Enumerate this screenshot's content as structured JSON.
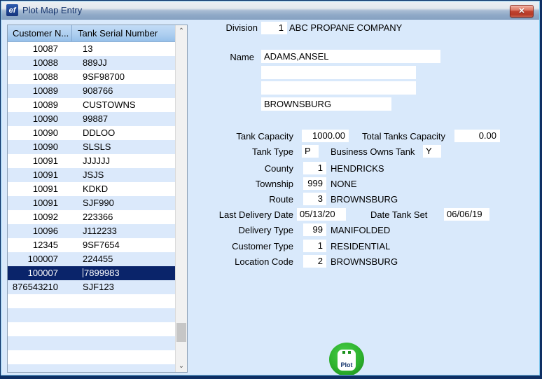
{
  "window": {
    "title": "Plot Map Entry",
    "icon_text": "ef",
    "close_glyph": "✕"
  },
  "table": {
    "columns": [
      "Customer N...",
      "Tank Serial Number"
    ],
    "rows": [
      [
        "10087",
        "13"
      ],
      [
        "10088",
        "889JJ"
      ],
      [
        "10088",
        "9SF98700"
      ],
      [
        "10089",
        "908766"
      ],
      [
        "10089",
        "CUSTOWNS"
      ],
      [
        "10090",
        "99887"
      ],
      [
        "10090",
        "DDLOO"
      ],
      [
        "10090",
        "SLSLS"
      ],
      [
        "10091",
        "JJJJJJ"
      ],
      [
        "10091",
        "JSJS"
      ],
      [
        "10091",
        "KDKD"
      ],
      [
        "10091",
        "SJF990"
      ],
      [
        "10092",
        "223366"
      ],
      [
        "10096",
        "J112233"
      ],
      [
        "12345",
        "9SF7654"
      ],
      [
        "100007",
        "224455"
      ],
      [
        "100007",
        "7899983"
      ],
      [
        "876543210",
        "SJF123"
      ]
    ],
    "selected_index": 16,
    "total_rows": 24,
    "scroll_up_glyph": "⌃",
    "scroll_down_glyph": "⌄"
  },
  "form": {
    "division": {
      "label": "Division",
      "value": "1",
      "company": "ABC PROPANE COMPANY"
    },
    "name_label": "Name",
    "name": "ADAMS,ANSEL",
    "address_line2": "",
    "address_line3": "",
    "city": "BROWNSBURG",
    "tank_capacity": {
      "label": "Tank Capacity",
      "value": "1000.00"
    },
    "total_tanks_capacity": {
      "label": "Total Tanks Capacity",
      "value": "0.00"
    },
    "tank_type": {
      "label": "Tank Type",
      "value": "P"
    },
    "business_owns_tank": {
      "label": "Business Owns Tank",
      "value": "Y"
    },
    "county": {
      "label": "County",
      "value": "1",
      "text": "HENDRICKS"
    },
    "township": {
      "label": "Township",
      "value": "999",
      "text": "NONE"
    },
    "route": {
      "label": "Route",
      "value": "3",
      "text": "BROWNSBURG"
    },
    "last_delivery_date": {
      "label": "Last Delivery Date",
      "value": "05/13/20"
    },
    "date_tank_set": {
      "label": "Date Tank Set",
      "value": "06/06/19"
    },
    "delivery_type": {
      "label": "Delivery Type",
      "value": "99",
      "text": "MANIFOLDED"
    },
    "customer_type": {
      "label": "Customer Type",
      "value": "1",
      "text": "RESIDENTIAL"
    },
    "location_code": {
      "label": "Location Code",
      "value": "2",
      "text": "BROWNSBURG"
    }
  },
  "plot_button": {
    "label": "Plot"
  },
  "colors": {
    "selection": "#0A246A",
    "row_alt": "#DBE9FB",
    "client_bg": "#D9E9FB",
    "plot_green": "#2EB22E",
    "close_red": "#C04430",
    "header_blue": "#AECFF0"
  }
}
